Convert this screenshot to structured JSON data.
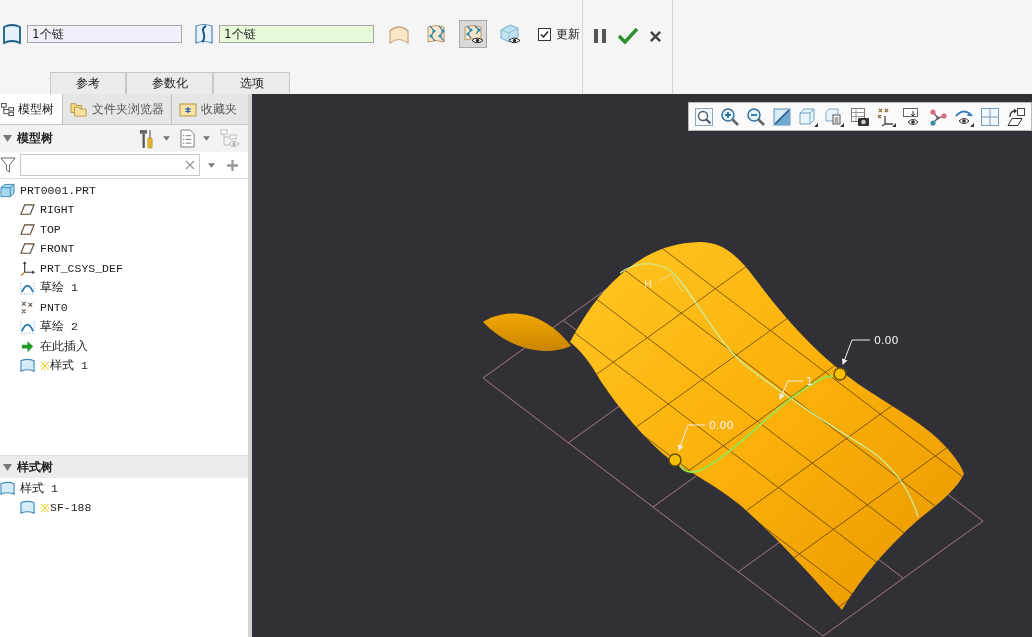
{
  "ribbon": {
    "fields": [
      {
        "value": "1个链",
        "color": "#f2eefa"
      },
      {
        "value": "1个链",
        "color": "#e6f9d9"
      }
    ],
    "tool_buttons": [
      {
        "selected": false
      },
      {
        "selected": false
      },
      {
        "selected": true
      },
      {
        "selected": false
      }
    ],
    "checkbox": {
      "label": "更新",
      "checked": true
    },
    "tabs": [
      {
        "label": "参考",
        "selected": false
      },
      {
        "label": "参数化",
        "selected": false
      },
      {
        "label": "选项",
        "selected": false
      }
    ]
  },
  "panel_tabs": [
    {
      "label": "模型树",
      "selected": true
    },
    {
      "label": "文件夹浏览器",
      "selected": false
    },
    {
      "label": "收藏夹",
      "selected": false
    }
  ],
  "model_tree": {
    "title": "模型树",
    "expanded": true,
    "items": [
      {
        "kind": "part",
        "label": "PRT0001.PRT",
        "children": [
          {
            "kind": "plane",
            "label": "RIGHT"
          },
          {
            "kind": "plane",
            "label": "TOP"
          },
          {
            "kind": "plane",
            "label": "FRONT"
          },
          {
            "kind": "csys",
            "label": "PRT_CSYS_DEF"
          },
          {
            "kind": "sketch",
            "label": "草绘 1"
          },
          {
            "kind": "point",
            "label": "PNT0"
          },
          {
            "kind": "sketch",
            "label": "草绘 2"
          },
          {
            "kind": "insert",
            "label": "在此插入"
          },
          {
            "kind": "surface",
            "marker": "※",
            "label": "样式 1"
          }
        ]
      }
    ]
  },
  "style_tree": {
    "title": "样式树",
    "expanded": true,
    "items": [
      {
        "kind": "surface",
        "label": "样式 1",
        "children": [
          {
            "kind": "surface",
            "marker": "※",
            "label": "SF-188"
          }
        ]
      }
    ]
  },
  "viewport": {
    "labels": [
      "H",
      "0.00",
      "1",
      "0.00"
    ]
  }
}
